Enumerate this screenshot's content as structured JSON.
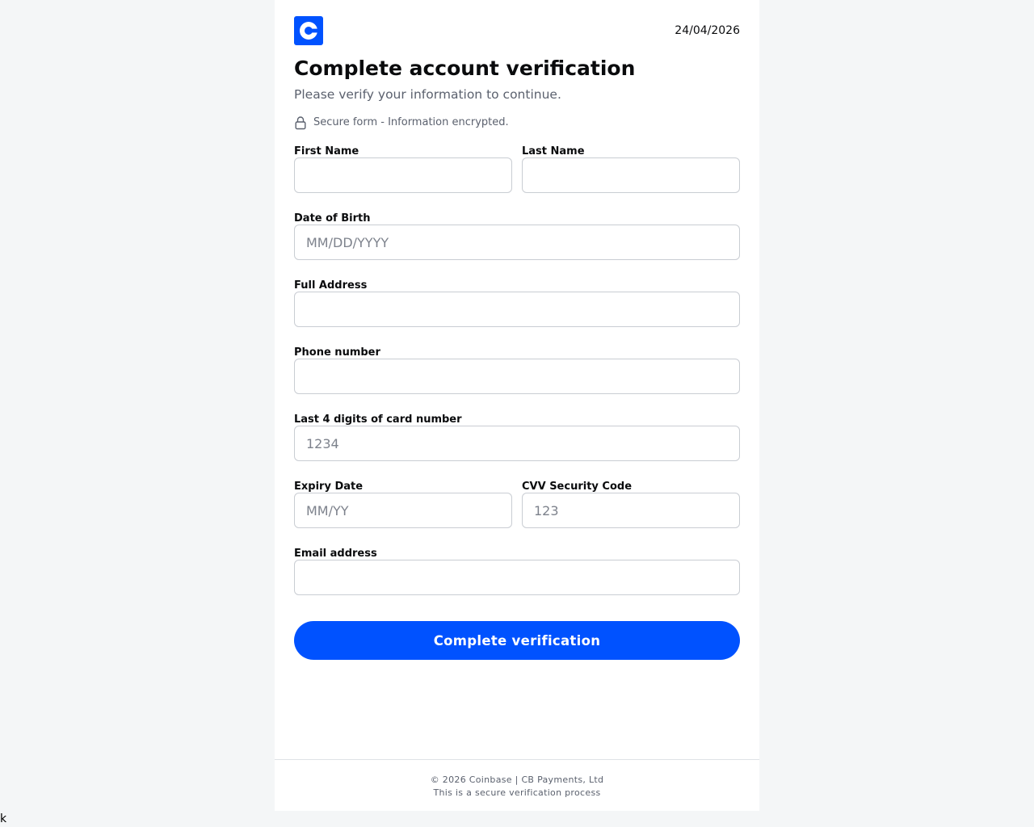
{
  "header": {
    "logo_icon": "coinbase-logo-icon",
    "date": "24/04/2026"
  },
  "title": "Complete account verification",
  "subtitle": "Please verify your information to continue.",
  "secure_note": {
    "icon": "lock-icon",
    "text": "Secure form - Information encrypted."
  },
  "form": {
    "first_name": {
      "label": "First Name",
      "placeholder": "",
      "value": ""
    },
    "last_name": {
      "label": "Last Name",
      "placeholder": "",
      "value": ""
    },
    "dob": {
      "label": "Date of Birth",
      "placeholder": "MM/DD/YYYY",
      "value": ""
    },
    "address": {
      "label": "Full Address",
      "placeholder": "",
      "value": ""
    },
    "phone": {
      "label": "Phone number",
      "placeholder": "",
      "value": ""
    },
    "card_last4": {
      "label": "Last 4 digits of card number",
      "placeholder": "1234",
      "value": ""
    },
    "expiry": {
      "label": "Expiry Date",
      "placeholder": "MM/YY",
      "value": ""
    },
    "cvv": {
      "label": "CVV Security Code",
      "placeholder": "123",
      "value": ""
    },
    "email": {
      "label": "Email address",
      "placeholder": "",
      "value": ""
    },
    "submit_label": "Complete verification"
  },
  "footer": {
    "line1": "© 2026 Coinbase | CB Payments, Ltd",
    "line2": "This is a secure verification process"
  },
  "stray_text": "k",
  "colors": {
    "accent": "#0052ff",
    "background": "#f4f6f7",
    "text": "#0a0b0d",
    "muted": "#5b616e"
  }
}
